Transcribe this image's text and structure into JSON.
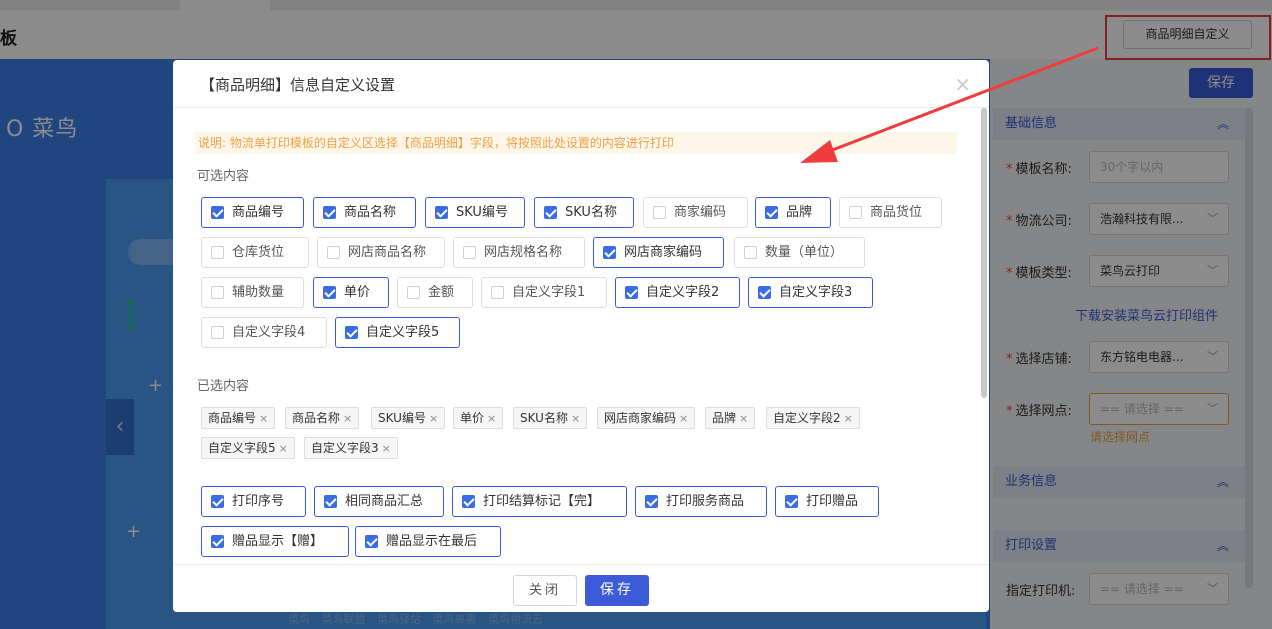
{
  "app": {
    "title": "板",
    "custom_button": "商品明细自定义",
    "logo_text": "O 菜鸟",
    "side_arrow": "‹",
    "footer_links": "菜鸟 菜鸟联盟 菜鸟驿站 菜鸟裹裹 菜鸟物流云",
    "save_button": "保存"
  },
  "right_form": {
    "section_basic": "基础信息",
    "section_business": "业务信息",
    "section_print": "打印设置",
    "template_name_label": "模板名称:",
    "template_name_placeholder": "30个字以内",
    "logistics_label": "物流公司:",
    "logistics_value": "浩瀚科技有限...",
    "template_type_label": "模板类型:",
    "template_type_value": "菜鸟云打印",
    "download_link": "下载安装菜鸟云打印组件",
    "shop_label": "选择店铺:",
    "shop_value": "东方铭电电器...",
    "outlet_label": "选择网点:",
    "outlet_placeholder": "== 请选择 ==",
    "outlet_error": "请选择网点",
    "printer_label": "指定打印机:",
    "printer_placeholder": "== 请选择 =="
  },
  "modal": {
    "title": "【商品明细】信息自定义设置",
    "close_icon": "×",
    "notice": "说明: 物流单打印模板的自定义区选择【商品明细】字段，将按照此处设置的内容进行打印",
    "optional_title": "可选内容",
    "selected_title": "已选内容",
    "optional_items": [
      {
        "label": "商品编号",
        "checked": true
      },
      {
        "label": "商品名称",
        "checked": true
      },
      {
        "label": "SKU编号",
        "checked": true
      },
      {
        "label": "SKU名称",
        "checked": true
      },
      {
        "label": "商家编码",
        "checked": false
      },
      {
        "label": "品牌",
        "checked": true
      },
      {
        "label": "商品货位",
        "checked": false
      },
      {
        "label": "仓库货位",
        "checked": false
      },
      {
        "label": "网店商品名称",
        "checked": false
      },
      {
        "label": "网店规格名称",
        "checked": false
      },
      {
        "label": "网店商家编码",
        "checked": true
      },
      {
        "label": "数量（单位）",
        "checked": false
      },
      {
        "label": "辅助数量",
        "checked": false
      },
      {
        "label": "单价",
        "checked": true
      },
      {
        "label": "金额",
        "checked": false
      },
      {
        "label": "自定义字段1",
        "checked": false
      },
      {
        "label": "自定义字段2",
        "checked": true
      },
      {
        "label": "自定义字段3",
        "checked": true
      },
      {
        "label": "自定义字段4",
        "checked": false
      },
      {
        "label": "自定义字段5",
        "checked": true
      }
    ],
    "selected_tags": [
      "商品编号",
      "商品名称",
      "SKU编号",
      "单价",
      "SKU名称",
      "网店商家编码",
      "品牌",
      "自定义字段2",
      "自定义字段5",
      "自定义字段3"
    ],
    "tag_remove_icon": "×",
    "option_items": [
      {
        "label": "打印序号",
        "checked": true
      },
      {
        "label": "相同商品汇总",
        "checked": true
      },
      {
        "label": "打印结算标记【完】",
        "checked": true
      },
      {
        "label": "打印服务商品",
        "checked": true
      },
      {
        "label": "打印赠品",
        "checked": true
      },
      {
        "label": "赠品显示【赠】",
        "checked": true
      },
      {
        "label": "赠品显示在最后",
        "checked": true
      }
    ],
    "close_button": "关闭",
    "save_button": "保存"
  }
}
